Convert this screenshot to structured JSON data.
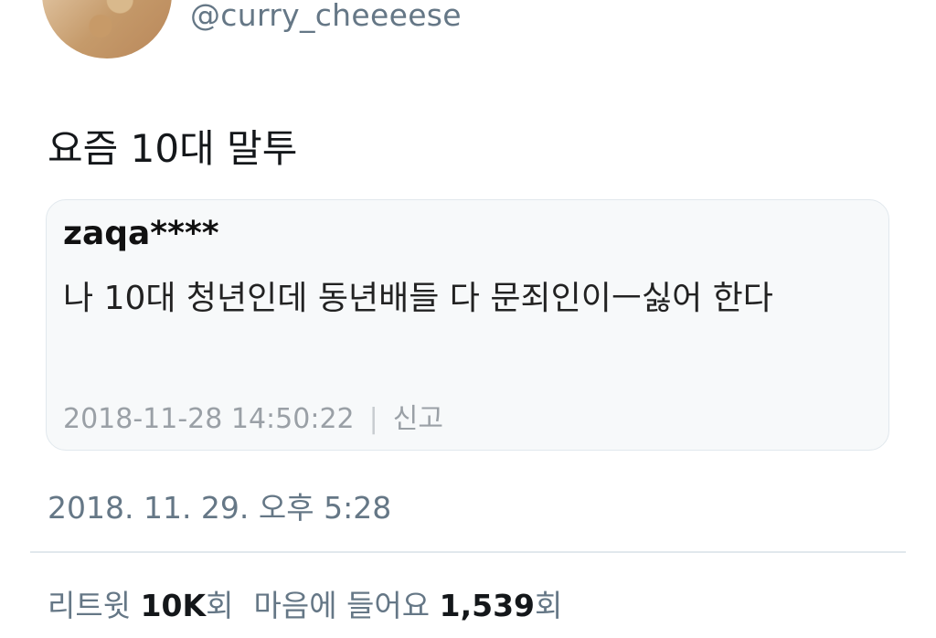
{
  "author": {
    "handle": "@curry_cheeeese"
  },
  "tweet": {
    "text": "요즘 10대 말투",
    "timestamp": "2018. 11. 29. 오후 5:28"
  },
  "quote": {
    "username": "zaqa****",
    "body": "나 10대 청년인데 동년배들 다 문죄인이ㅡ싫어 한다",
    "datetime": "2018-11-28 14:50:22",
    "separator": "|",
    "report_label": "신고"
  },
  "stats": {
    "retweets_label": "리트윗",
    "retweets_count": "10K",
    "retweets_unit": "회",
    "likes_label": "마음에 들어요",
    "likes_count": "1,539",
    "likes_unit": "회"
  }
}
